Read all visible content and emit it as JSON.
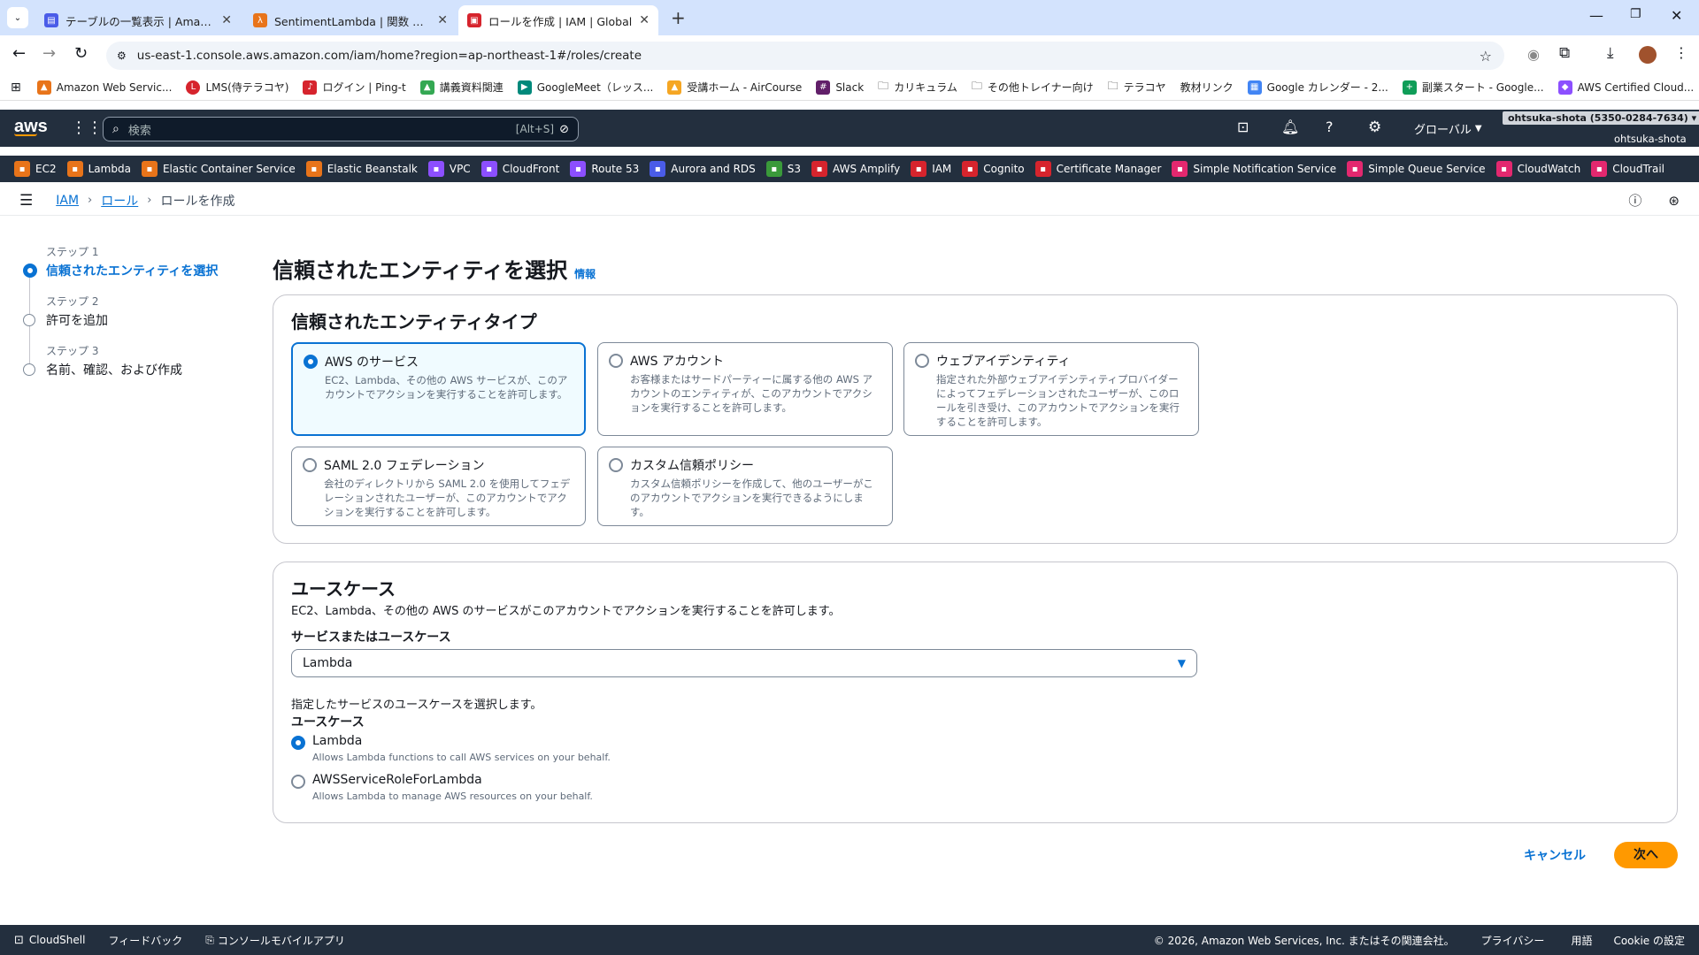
{
  "browser": {
    "tabs": [
      {
        "title": "テーブルの一覧表示 | Amazon Dy",
        "color": "#4a5ce8"
      },
      {
        "title": "SentimentLambda | 関数 | Lamb",
        "color": "#e8741a"
      },
      {
        "title": "ロールを作成 | IAM | Global",
        "color": "#d6242d"
      }
    ],
    "url": "us-east-1.console.aws.amazon.com/iam/home?region=ap-northeast-1#/roles/create",
    "bookmarks": [
      "Amazon Web Servic...",
      "LMS(侍テラコヤ)",
      "ログイン | Ping-t",
      "講義資料関連",
      "GoogleMeet（レッス...",
      "受講ホーム - AirCourse",
      "Slack",
      "カリキュラム",
      "その他トレイナー向け",
      "テラコヤ",
      "教材リンク",
      "Google カレンダー - 2...",
      "副業スタート - Google...",
      "AWS Certified Cloud..."
    ]
  },
  "aws": {
    "logo": "aws",
    "search_placeholder": "検索",
    "search_shortcut": "[Alt+S]",
    "region": "グローバル",
    "account": "ohtsuka-shota (5350-0284-7634)",
    "user": "ohtsuka-shota",
    "services": [
      {
        "name": "EC2",
        "color": "#e8741a"
      },
      {
        "name": "Lambda",
        "color": "#e8741a"
      },
      {
        "name": "Elastic Container Service",
        "color": "#e8741a"
      },
      {
        "name": "Elastic Beanstalk",
        "color": "#e8741a"
      },
      {
        "name": "VPC",
        "color": "#8c4fff"
      },
      {
        "name": "CloudFront",
        "color": "#8c4fff"
      },
      {
        "name": "Route 53",
        "color": "#8c4fff"
      },
      {
        "name": "Aurora and RDS",
        "color": "#4a5ce8"
      },
      {
        "name": "S3",
        "color": "#3a9a3a"
      },
      {
        "name": "AWS Amplify",
        "color": "#d6242d"
      },
      {
        "name": "IAM",
        "color": "#d6242d"
      },
      {
        "name": "Cognito",
        "color": "#d6242d"
      },
      {
        "name": "Certificate Manager",
        "color": "#d6242d"
      },
      {
        "name": "Simple Notification Service",
        "color": "#e3286f"
      },
      {
        "name": "Simple Queue Service",
        "color": "#e3286f"
      },
      {
        "name": "CloudWatch",
        "color": "#e3286f"
      },
      {
        "name": "CloudTrail",
        "color": "#e3286f"
      }
    ],
    "breadcrumb": [
      "IAM",
      "ロール",
      "ロールを作成"
    ]
  },
  "steps": [
    {
      "step": "ステップ 1",
      "label": "信頼されたエンティティを選択"
    },
    {
      "step": "ステップ 2",
      "label": "許可を追加"
    },
    {
      "step": "ステップ 3",
      "label": "名前、確認、および作成"
    }
  ],
  "page": {
    "title": "信頼されたエンティティを選択",
    "info": "情報",
    "entity_panel_title": "信頼されたエンティティタイプ",
    "tiles": [
      {
        "title": "AWS のサービス",
        "desc": "EC2、Lambda、その他の AWS サービスが、このアカウントでアクションを実行することを許可します。"
      },
      {
        "title": "AWS アカウント",
        "desc": "お客様またはサードパーティーに属する他の AWS アカウントのエンティティが、このアカウントでアクションを実行することを許可します。"
      },
      {
        "title": "ウェブアイデンティティ",
        "desc": "指定された外部ウェブアイデンティティプロバイダーによってフェデレーションされたユーザーが、このロールを引き受け、このアカウントでアクションを実行することを許可します。"
      },
      {
        "title": "SAML 2.0 フェデレーション",
        "desc": "会社のディレクトリから SAML 2.0 を使用してフェデレーションされたユーザーが、このアカウントでアクションを実行することを許可します。"
      },
      {
        "title": "カスタム信頼ポリシー",
        "desc": "カスタム信頼ポリシーを作成して、他のユーザーがこのアカウントでアクションを実行できるようにします。"
      }
    ],
    "usecase_title": "ユースケース",
    "usecase_desc": "EC2、Lambda、その他の AWS のサービスがこのアカウントでアクションを実行することを許可します。",
    "service_label": "サービスまたはユースケース",
    "service_value": "Lambda",
    "choose_hint": "指定したサービスのユースケースを選択します。",
    "usecase_label": "ユースケース",
    "usecases": [
      {
        "title": "Lambda",
        "desc": "Allows Lambda functions to call AWS services on your behalf."
      },
      {
        "title": "AWSServiceRoleForLambda",
        "desc": "Allows Lambda to manage AWS resources on your behalf."
      }
    ],
    "cancel": "キャンセル",
    "next": "次へ"
  },
  "footer": {
    "cloudshell": "CloudShell",
    "feedback": "フィードバック",
    "mobile": "コンソールモバイルアプリ",
    "copyright": "© 2026, Amazon Web Services, Inc. またはその関連会社。",
    "privacy": "プライバシー",
    "terms": "用語",
    "cookie": "Cookie の設定"
  }
}
